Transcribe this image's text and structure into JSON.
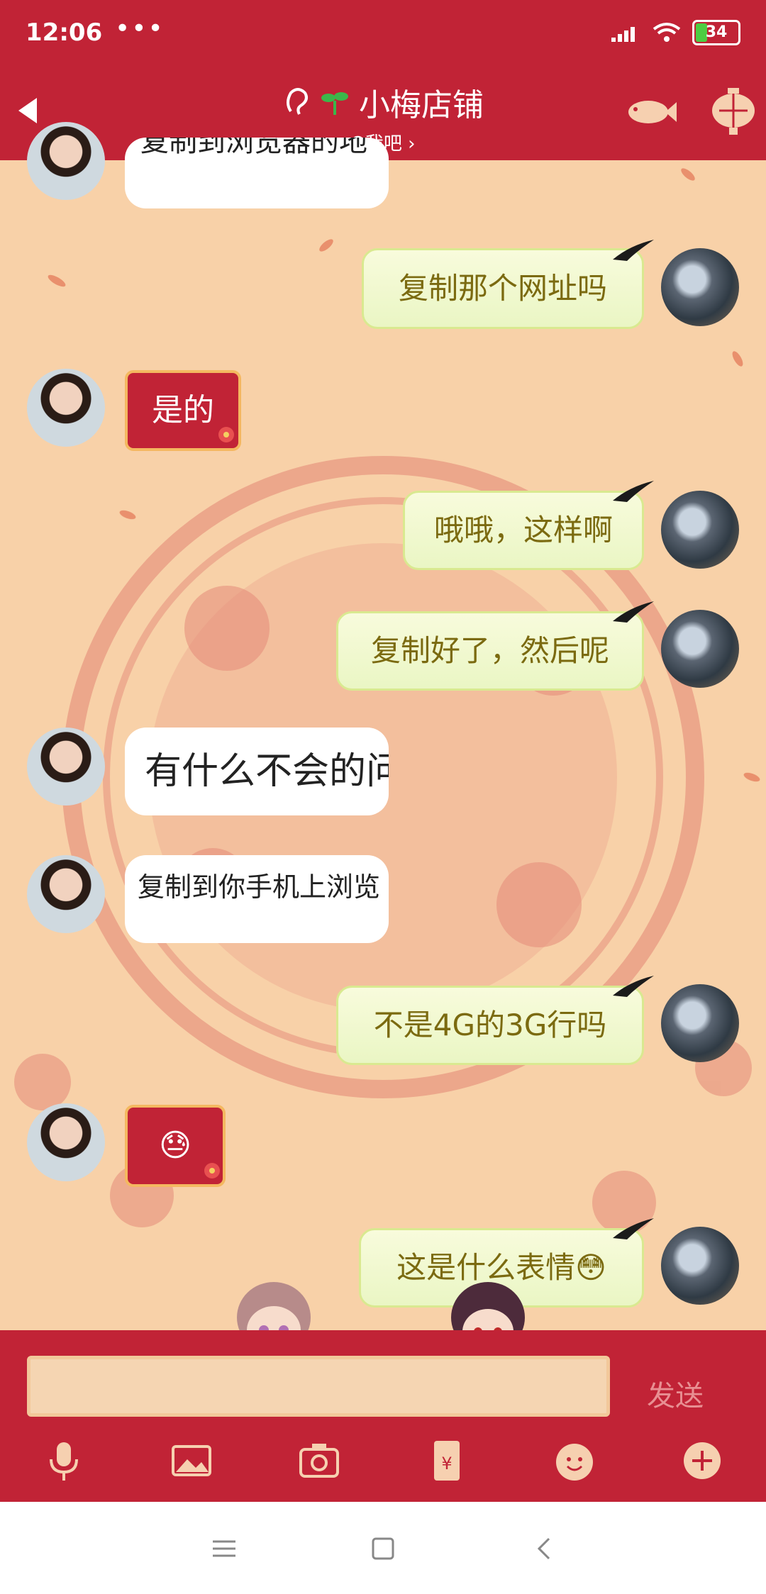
{
  "status": {
    "time": "12:06",
    "dots": "•••",
    "battery": "34"
  },
  "header": {
    "title": "小梅店铺",
    "subtitle": "Q我吧 ›"
  },
  "messages": [
    {
      "side": "left",
      "style": "white",
      "text": "复制到浏览器的地"
    },
    {
      "side": "right",
      "style": "green",
      "text": "复制那个网址吗"
    },
    {
      "side": "left",
      "style": "red",
      "text": "是的"
    },
    {
      "side": "right",
      "style": "green",
      "text": "哦哦，这样啊"
    },
    {
      "side": "right",
      "style": "green",
      "text": "复制好了，然后呢"
    },
    {
      "side": "left",
      "style": "white",
      "text": "有什么不会的问"
    },
    {
      "side": "left",
      "style": "white",
      "text": "复制到你手机上浏览"
    },
    {
      "side": "right",
      "style": "green",
      "text": "不是4G的3G行吗"
    },
    {
      "side": "left",
      "style": "red",
      "text": "😓"
    },
    {
      "side": "right",
      "style": "green",
      "text": "这是什么表情😳"
    }
  ],
  "input": {
    "placeholder": "",
    "send_label": "发送"
  },
  "toolbar": [
    "mic-icon",
    "image-icon",
    "camera-icon",
    "red-packet-icon",
    "emoji-icon",
    "plus-icon"
  ],
  "colors": {
    "primary": "#c12336",
    "bubble_green_text": "#7b6a10",
    "background": "#f8d1a8"
  }
}
